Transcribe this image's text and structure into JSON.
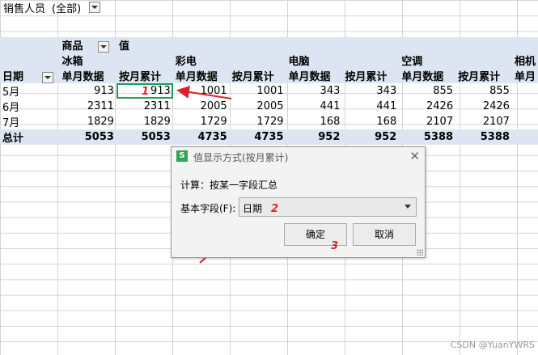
{
  "filter": {
    "label": "销售人员",
    "value": "(全部)"
  },
  "pivot": {
    "field_label": "商品",
    "values_label": "值",
    "row_header": "日期",
    "groups": [
      "冰箱",
      "彩电",
      "电脑",
      "空调",
      "相机"
    ],
    "subheaders": [
      "单月数据",
      "按月累计",
      "单月数据",
      "按月累计",
      "单月数据",
      "按月累计",
      "单月数据",
      "按月累计",
      "单月"
    ],
    "rows": [
      {
        "label": "5月",
        "values": [
          "913",
          "913",
          "1001",
          "1001",
          "343",
          "343",
          "855",
          "855"
        ]
      },
      {
        "label": "6月",
        "values": [
          "2311",
          "2311",
          "2005",
          "2005",
          "441",
          "441",
          "2426",
          "2426"
        ]
      },
      {
        "label": "7月",
        "values": [
          "1829",
          "1829",
          "1729",
          "1729",
          "168",
          "168",
          "2107",
          "2107"
        ]
      }
    ],
    "total": {
      "label": "总计",
      "values": [
        "5053",
        "5053",
        "4735",
        "4735",
        "952",
        "952",
        "5388",
        "5388"
      ]
    }
  },
  "dialog": {
    "logo": "S",
    "title": "值显示方式(按月累计)",
    "calc_text": "计算：按某一字段汇总",
    "field_label": "基本字段(F):",
    "field_value": "日期",
    "ok": "确定",
    "cancel": "取消"
  },
  "steps": [
    "1",
    "2",
    "3"
  ],
  "watermark": "CSDN @YuanYWRS",
  "colors": {
    "accent_arrow": "#e0202a",
    "selection": "#1e9e5a",
    "header_bg": "#dde5f2"
  }
}
